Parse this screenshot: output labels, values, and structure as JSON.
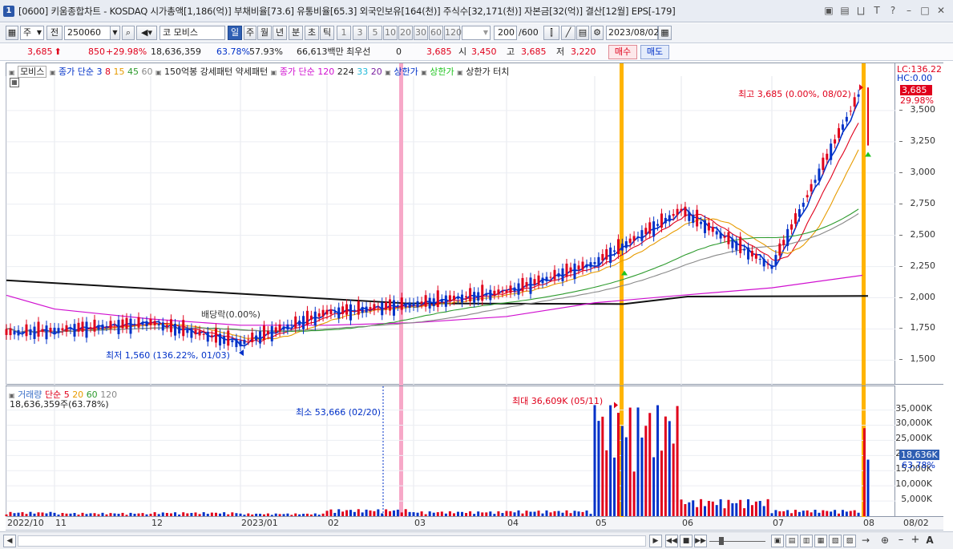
{
  "window": {
    "badge": "1",
    "title": "[0600] 키움종합차트 - KOSDAQ 시가총액[1,186(억)] 부채비율[73.6] 유통비율[65.3] 외국인보유[164(천)] 주식수[32,171(천)] 자본금[32(억)] 결산[12월] EPS[-179]"
  },
  "toolbar": {
    "market": "주",
    "prev": "전",
    "code": "250060",
    "name_prefix": "코",
    "name": "모비스",
    "periods": [
      "일",
      "주",
      "월",
      "년",
      "분",
      "초",
      "틱"
    ],
    "active_period": "일",
    "intervals": [
      "1",
      "3",
      "5",
      "10",
      "20",
      "30",
      "60",
      "120"
    ],
    "count": "200",
    "count_total": "/600",
    "date": "2023/08/02"
  },
  "quote": {
    "price": "3,685",
    "change": "850",
    "change_pct": "+29.98%",
    "volume": "18,636,359",
    "vol_ratio": "63.78%",
    "ratio2": "57.93%",
    "amount": "66,613백만",
    "pref_label": "최우선",
    "pref_value": "0",
    "last": "3,685",
    "open_label": "시",
    "open": "3,450",
    "high_label": "고",
    "high": "3,685",
    "low_label": "저",
    "low": "3,220",
    "buy": "매수",
    "sell": "매도"
  },
  "price_legend": {
    "name": "모비스",
    "ma_label": "종가 단순",
    "ma1": "3",
    "ma2": "8",
    "ma3": "15",
    "ma4": "45",
    "ma5": "60",
    "pattern": "150억봉 강세패턴",
    "pattern2": "약세패턴",
    "ma120_label": "종가 단순 120",
    "ma120_a": "224",
    "ma120_b": "33",
    "ma120_c": "20",
    "limit_up": "상한가",
    "limit_up2": "상한가",
    "limit_touch": "상한가 터치"
  },
  "price_axis": {
    "lc": "LC:136.22",
    "hc": "HC:0.00",
    "last_tag": "3,685",
    "pct_tag": "29.98%",
    "ticks": [
      "3,500",
      "3,250",
      "3,000",
      "2,750",
      "2,500",
      "2,250",
      "2,000",
      "1,750",
      "1,500"
    ]
  },
  "annotations": {
    "high": "최고 3,685 (0.00%, 08/02)",
    "low": "최저 1,560 (136.22%, 01/03)",
    "dividend": "배당락(0.00%)",
    "vol_max": "최대 36,609K (05/11)",
    "vol_min": "최소 53,666 (02/20)"
  },
  "vol_legend": {
    "name": "거래량",
    "ma_label": "단순",
    "m1": "5",
    "m2": "20",
    "m3": "60",
    "m4": "120",
    "value": "18,636,359주(63.78%)"
  },
  "vol_axis": {
    "ticks": [
      "35,000K",
      "30,000K",
      "25,000K",
      "20,000K",
      "15,000K",
      "10,000K",
      "5,000K"
    ],
    "last_tag": "18,636K",
    "pct_tag": "63.78%"
  },
  "dates": [
    "2022/10",
    "11",
    "12",
    "2023/01",
    "02",
    "03",
    "04",
    "05",
    "06",
    "07",
    "08",
    "08/02"
  ],
  "colors": {
    "up": "#e0001b",
    "down": "#0031c8",
    "accent": "#2f5fb3",
    "marker_orange": "#ffb400",
    "marker_pink": "#f7a8c8"
  },
  "chart_data": [
    {
      "type": "line",
      "ylim": [
        1400,
        3750
      ],
      "x": [
        "2022/10",
        "11",
        "12",
        "2023/01",
        "02",
        "03",
        "04",
        "05",
        "06",
        "07",
        "08"
      ],
      "series": [
        {
          "name": "종가 단순 3",
          "values": [
            1720,
            1740,
            1800,
            1640,
            1880,
            1950,
            2050,
            2280,
            2700,
            2250,
            3685
          ]
        },
        {
          "name": "종가 단순 120",
          "values": [
            2020,
            1910,
            1830,
            1780,
            1780,
            1800,
            1850,
            1960,
            2020,
            2080,
            2180
          ]
        }
      ]
    },
    {
      "type": "bar",
      "ylim": [
        0,
        37000
      ],
      "categories": [
        "2022/10",
        "11",
        "12",
        "2023/01",
        "02",
        "03",
        "04",
        "05",
        "06",
        "07",
        "08"
      ],
      "series": [
        {
          "name": "거래량",
          "values": [
            1400,
            1100,
            1300,
            900,
            2300,
            1600,
            1900,
            36609,
            5600,
            2100,
            18636
          ]
        }
      ]
    }
  ]
}
